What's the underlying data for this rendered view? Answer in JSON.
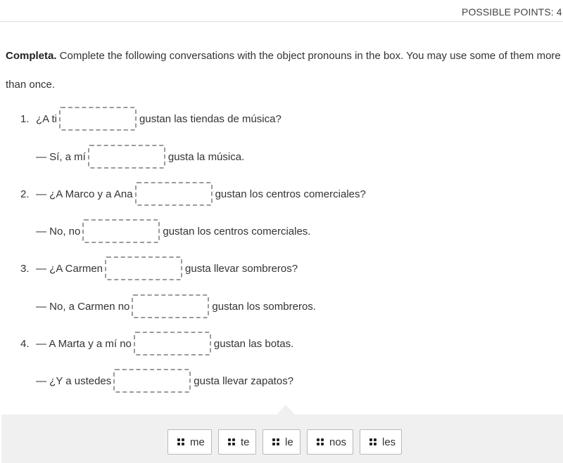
{
  "header": {
    "possible_points": "POSSIBLE POINTS: 4"
  },
  "instructions": {
    "bold": "Completa.",
    "text": " Complete the following conversations with the object pronouns in the box. You may use some of them more than once."
  },
  "questions": [
    {
      "number": "1.",
      "lead": "¿A ti",
      "trail": "gustan las tiendas de música?",
      "answer": ""
    },
    {
      "number": "",
      "lead": "— Sí, a mí",
      "trail": "gusta la música.",
      "answer": ""
    },
    {
      "number": "2.",
      "lead": "— ¿A Marco y a Ana",
      "trail": "gustan los centros comerciales?",
      "answer": ""
    },
    {
      "number": "",
      "lead": "— No, no",
      "trail": "gustan los centros comerciales.",
      "answer": ""
    },
    {
      "number": "3.",
      "lead": "— ¿A Carmen",
      "trail": "gusta llevar sombreros?",
      "answer": ""
    },
    {
      "number": "",
      "lead": "— No, a Carmen no",
      "trail": "gustan los sombreros.",
      "answer": ""
    },
    {
      "number": "4.",
      "lead": "— A Marta y a mí no",
      "trail": "gustan las botas.",
      "answer": ""
    },
    {
      "number": "",
      "lead": "— ¿Y a ustedes",
      "trail": "gusta llevar zapatos?",
      "answer": ""
    }
  ],
  "word_bank": [
    {
      "label": "me",
      "icon": "drag-handle-icon"
    },
    {
      "label": "te",
      "icon": "drag-handle-icon"
    },
    {
      "label": "le",
      "icon": "drag-handle-icon"
    },
    {
      "label": "nos",
      "icon": "drag-handle-icon"
    },
    {
      "label": "les",
      "icon": "drag-handle-icon"
    }
  ]
}
